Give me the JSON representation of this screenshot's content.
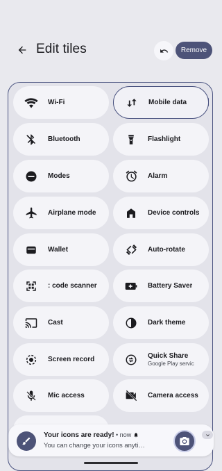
{
  "header": {
    "title": "Edit tiles",
    "remove_label": "Remove"
  },
  "tiles": [
    {
      "label": "Wi-Fi",
      "icon": "wifi-icon",
      "selected": false
    },
    {
      "label": "Mobile data",
      "icon": "mobile-data-icon",
      "selected": true
    },
    {
      "label": "Bluetooth",
      "icon": "bluetooth-off-icon",
      "selected": false
    },
    {
      "label": "Flashlight",
      "icon": "flashlight-icon",
      "selected": false
    },
    {
      "label": "Modes",
      "icon": "modes-icon",
      "selected": false
    },
    {
      "label": "Alarm",
      "icon": "alarm-icon",
      "selected": false
    },
    {
      "label": "Airplane mode",
      "icon": "airplane-icon",
      "selected": false
    },
    {
      "label": "Device controls",
      "icon": "home-icon",
      "selected": false
    },
    {
      "label": "Wallet",
      "icon": "wallet-icon",
      "selected": false
    },
    {
      "label": "Auto-rotate",
      "icon": "auto-rotate-icon",
      "selected": false
    },
    {
      "label": ": code scanner",
      "icon": "qr-scanner-icon",
      "selected": false
    },
    {
      "label": "Battery Saver",
      "icon": "battery-saver-icon",
      "selected": false
    },
    {
      "label": "Cast",
      "icon": "cast-icon",
      "selected": false
    },
    {
      "label": "Dark theme",
      "icon": "dark-theme-icon",
      "selected": false
    },
    {
      "label": "Screen record",
      "icon": "screen-record-icon",
      "selected": false
    },
    {
      "label": "Quick Share",
      "sublabel": "Google Play servic",
      "icon": "quick-share-icon",
      "selected": false
    },
    {
      "label": "Mic access",
      "icon": "mic-off-icon",
      "selected": false
    },
    {
      "label": "Camera access",
      "icon": "camera-off-icon",
      "selected": false
    }
  ],
  "notification": {
    "title": "Your icons are ready!",
    "meta": " • now",
    "body": "You can change your icons anyti…",
    "action_icon": "camera-icon"
  },
  "colors": {
    "accent": "#4d5378",
    "background": "#e9e9ee",
    "tile": "#f4f4f8"
  }
}
